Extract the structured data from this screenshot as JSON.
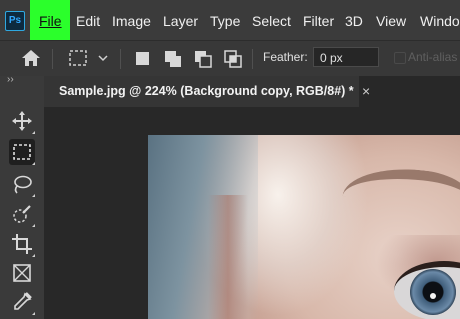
{
  "app": {
    "logo": "Ps"
  },
  "menu": {
    "items": [
      {
        "label": "File",
        "highlighted": true
      },
      {
        "label": "Edit"
      },
      {
        "label": "Image"
      },
      {
        "label": "Layer"
      },
      {
        "label": "Type"
      },
      {
        "label": "Select"
      },
      {
        "label": "Filter"
      },
      {
        "label": "3D"
      },
      {
        "label": "View"
      },
      {
        "label": "Windo"
      }
    ],
    "highlight_color": "#2bff2b"
  },
  "options": {
    "feather_label": "Feather:",
    "feather_value": "0 px",
    "antialias_label": "Anti-alias",
    "icons": [
      "home-icon",
      "marquee-icon",
      "chevron-down-icon",
      "new-selection-icon",
      "add-selection-icon",
      "subtract-selection-icon",
      "intersect-selection-icon"
    ]
  },
  "toolbar": {
    "collapse": "››",
    "tools": [
      "move-tool-icon",
      "rectangular-marquee-icon",
      "lasso-icon",
      "quick-selection-icon",
      "crop-icon",
      "frame-icon",
      "eyedropper-icon"
    ],
    "active": "rectangular-marquee-icon"
  },
  "document": {
    "tab_title": "Sample.jpg @ 224% (Background copy, RGB/8#) *",
    "close": "×"
  }
}
